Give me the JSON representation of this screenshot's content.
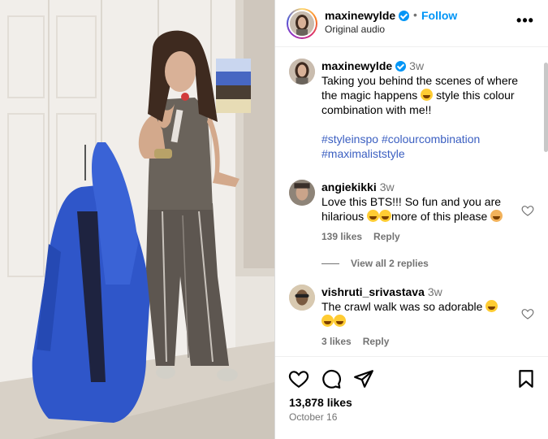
{
  "post": {
    "username": "maxinewylde",
    "follow_label": "Follow",
    "separator": "•",
    "audio": "Original audio",
    "more_label": "•••"
  },
  "caption": {
    "username": "maxinewylde",
    "time": "3w",
    "text": "Taking you behind the scenes of where the magic happens",
    "text2": "style this colour combination with me!!",
    "hashtags": [
      "#styleinspo",
      "#colourcombination",
      "#maximaliststyle"
    ]
  },
  "comments": [
    {
      "username": "angiekikki",
      "time": "3w",
      "text1": "Love this BTS!!! So fun and you are hilarious",
      "text2": "more of this please",
      "likes": "139 likes",
      "reply": "Reply",
      "replies_label": "View all 2 replies"
    },
    {
      "username": "vishruti_srivastava",
      "time": "3w",
      "text1": "The crawl walk was so adorable",
      "likes": "3 likes",
      "reply": "Reply"
    }
  ],
  "footer": {
    "likes": "13,878 likes",
    "date": "October 16"
  },
  "colors": {
    "accent": "#0095f6",
    "hashtag": "#3b5fc1",
    "muted": "#737373"
  },
  "icons": [
    "verified-badge-icon",
    "more-options-icon",
    "heart-icon",
    "comment-icon",
    "share-icon",
    "bookmark-icon"
  ]
}
